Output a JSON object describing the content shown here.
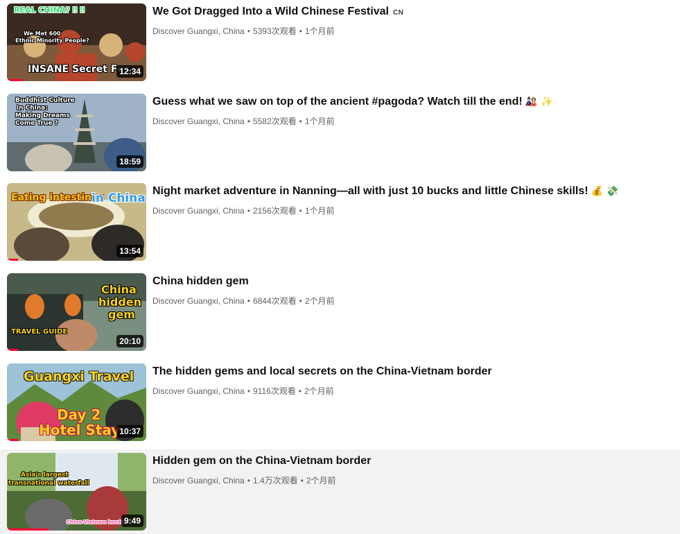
{
  "videos": [
    {
      "title": "We Got Dragged Into a Wild Chinese Festival",
      "badge": "CN",
      "emojis": "",
      "channel": "Discover Guangxi, China",
      "views": "5393次观看",
      "age": "1个月前",
      "duration": "12:34",
      "progress": 0.11,
      "hovered": false,
      "overlays": [
        "REAL CHINA? ‼ ‼",
        "We Met 600",
        "Ethnic Minority People?",
        "INSANE Secret Fes"
      ],
      "palette": [
        "#3a2a22",
        "#7d5a3c",
        "#b6462c",
        "#d7b37a"
      ]
    },
    {
      "title": "Guess what we saw on top of the ancient #pagoda? Watch till the end!",
      "badge": "",
      "emojis": "🎎 ✨",
      "channel": "Discover Guangxi, China",
      "views": "5582次观看",
      "age": "1个月前",
      "duration": "18:59",
      "progress": 0,
      "hovered": false,
      "overlays": [
        "Buddhist Culture",
        "in China:",
        "Making Dreams",
        "Come True ?"
      ],
      "palette": [
        "#9eb3c8",
        "#5f6b6f",
        "#3d4a3e",
        "#c9c2b2"
      ]
    },
    {
      "title": "Night market adventure in Nanning—all with just 10 bucks and little Chinese skills!",
      "badge": "",
      "emojis": "💰 💸",
      "channel": "Discover Guangxi, China",
      "views": "2156次观看",
      "age": "1个月前",
      "duration": "13:54",
      "progress": 0.08,
      "hovered": false,
      "overlays": [
        "Eating intestines",
        "in China"
      ],
      "palette": [
        "#c8b98a",
        "#8f7b4e",
        "#f1ead2",
        "#5a4a3a"
      ]
    },
    {
      "title": "China hidden gem",
      "badge": "",
      "emojis": "",
      "channel": "Discover Guangxi, China",
      "views": "6844次观看",
      "age": "2个月前",
      "duration": "20:10",
      "progress": 0.08,
      "hovered": false,
      "overlays": [
        "China",
        "hidden",
        "gem",
        "TRAVEL GUIDE"
      ],
      "palette": [
        "#4a5b4e",
        "#e07b2b",
        "#7b8f80",
        "#2c3430"
      ]
    },
    {
      "title": "The hidden gems and local secrets on the China-Vietnam border",
      "badge": "",
      "emojis": "",
      "channel": "Discover Guangxi, China",
      "views": "9116次观看",
      "age": "2个月前",
      "duration": "10:37",
      "progress": 0.08,
      "hovered": false,
      "overlays": [
        "Guangxi Travel",
        "Day 2",
        "Hotel Stay"
      ],
      "palette": [
        "#9cc3d8",
        "#5f8a3e",
        "#d9c9a4",
        "#e03a66"
      ]
    },
    {
      "title": "Hidden gem on the China-Vietnam border",
      "badge": "",
      "emojis": "",
      "channel": "Discover Guangxi, China",
      "views": "1.4万次观看",
      "age": "2个月前",
      "duration": "9:49",
      "progress": 0.3,
      "hovered": true,
      "overlays": [
        "Asia's largest",
        "transnational waterfall",
        "China-Vietnam border"
      ],
      "palette": [
        "#8fb56a",
        "#dfe8ee",
        "#4d6b34",
        "#a83a3a"
      ]
    }
  ]
}
